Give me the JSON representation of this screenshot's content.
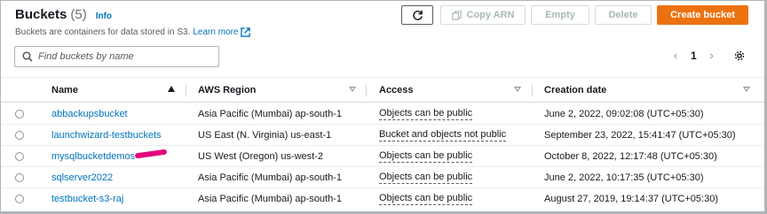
{
  "header": {
    "title": "Buckets",
    "count": "(5)",
    "info": "Info",
    "description": "Buckets are containers for data stored in S3.",
    "learn_more": "Learn more"
  },
  "toolbar": {
    "copy_arn": "Copy ARN",
    "empty": "Empty",
    "delete": "Delete",
    "create_bucket": "Create bucket"
  },
  "search": {
    "placeholder": "Find buckets by name"
  },
  "pagination": {
    "prev": "‹",
    "page": "1",
    "next": "›"
  },
  "columns": {
    "name": "Name",
    "region": "AWS Region",
    "access": "Access",
    "created": "Creation date"
  },
  "rows": [
    {
      "name": "abbackupsbucket",
      "region": "Asia Pacific (Mumbai) ap-south-1",
      "access": "Objects can be public",
      "created": "June 2, 2022, 09:02:08 (UTC+05:30)"
    },
    {
      "name": "launchwizard-testbuckets",
      "region": "US East (N. Virginia) us-east-1",
      "access": "Bucket and objects not public",
      "created": "September 23, 2022, 15:41:47 (UTC+05:30)"
    },
    {
      "name": "mysqlbucketdemos",
      "region": "US West (Oregon) us-west-2",
      "access": "Objects can be public",
      "created": "October 8, 2022, 12:17:48 (UTC+05:30)"
    },
    {
      "name": "sqlserver2022",
      "region": "Asia Pacific (Mumbai) ap-south-1",
      "access": "Objects can be public",
      "created": "June 2, 2022, 10:17:35 (UTC+05:30)"
    },
    {
      "name": "testbucket-s3-raj",
      "region": "Asia Pacific (Mumbai) ap-south-1",
      "access": "Objects can be public",
      "created": "August 27, 2019, 19:14:37 (UTC+05:30)"
    }
  ],
  "colors": {
    "link": "#0073bb",
    "primary_button": "#ec7211",
    "redaction_mark": "#e6007e"
  }
}
